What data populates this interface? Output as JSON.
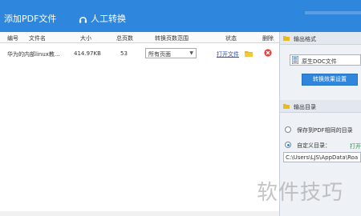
{
  "toolbar": {
    "add_pdf": "添加PDF文件",
    "manual": "人工转换"
  },
  "table": {
    "headers": [
      "编号",
      "文件名",
      "大小",
      "总页数",
      "转换页数范围",
      "状态",
      "删除"
    ],
    "rows": [
      {
        "file_name": "华为的内部linux教...",
        "size": "414.97KB",
        "pages": "53",
        "range": "所有页面",
        "status": "打开文件"
      }
    ]
  },
  "panel": {
    "output_format_title": "输出格式",
    "format_value": "原生DOC文件",
    "effect_button": "转换效果设置",
    "output_dir_title": "输出目录",
    "option_same_dir": "保存到PDF相同的目录",
    "option_custom_dir": "自定义目录：",
    "open_link": "打开",
    "path": "C:\\Users\\LJS\\AppData\\Roa"
  },
  "watermark": "软件技巧",
  "colors": {
    "toolbar": "#2f86dd",
    "link": "#1a4fd6",
    "open_link": "#1a9a3a"
  }
}
